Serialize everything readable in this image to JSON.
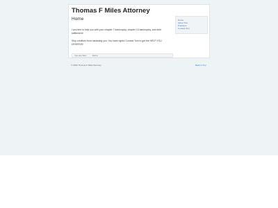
{
  "site": {
    "title": "Thomas F Miles Attorney"
  },
  "page": {
    "heading": "Home",
    "paragraphs": [
      "I am here to help you with your chapter 7 bankruptcy, chapter 13 bankruptcy, and debt settlement!",
      "Stop creditors from harassing you. You have rights! Contact Tom to get the HELP YOU DESERVE!"
    ],
    "meta": [
      "You are here:",
      "Home"
    ]
  },
  "sidebar": {
    "links": [
      "Home",
      "About Tom",
      "Practices",
      "Contact Tom"
    ]
  },
  "footer": {
    "copyright": "© 2020 Thomas F Miles Attorney",
    "back_to_top": "Back to Top"
  }
}
